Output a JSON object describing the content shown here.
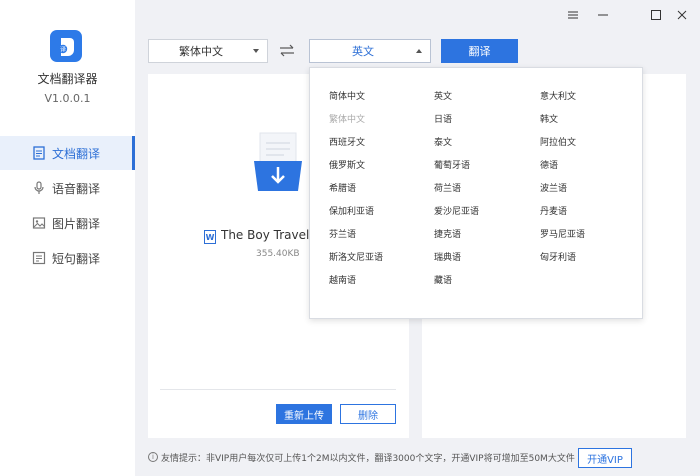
{
  "app": {
    "name": "文档翻译器",
    "version": "V1.0.0.1"
  },
  "nav": [
    {
      "label": "文档翻译",
      "icon": "document-icon",
      "active": true
    },
    {
      "label": "语音翻译",
      "icon": "microphone-icon",
      "active": false
    },
    {
      "label": "图片翻译",
      "icon": "image-icon",
      "active": false
    },
    {
      "label": "短句翻译",
      "icon": "text-icon",
      "active": false
    }
  ],
  "toolbar": {
    "source_lang": "繁体中文",
    "target_lang": "英文",
    "translate_label": "翻译"
  },
  "file": {
    "name": "The Boy Travellers",
    "size": "355.40KB",
    "type_letter": "W"
  },
  "actions": {
    "reupload": "重新上传",
    "delete": "删除"
  },
  "dropdown": {
    "col1": [
      "简体中文",
      "繁体中文",
      "西班牙文",
      "俄罗斯文",
      "希腊语",
      "保加利亚语",
      "芬兰语",
      "斯洛文尼亚语",
      "越南语"
    ],
    "col2": [
      "英文",
      "日语",
      "泰文",
      "葡萄牙语",
      "荷兰语",
      "爱沙尼亚语",
      "捷克语",
      "瑞典语",
      "藏语"
    ],
    "col3": [
      "意大利文",
      "韩文",
      "阿拉伯文",
      "德语",
      "波兰语",
      "丹麦语",
      "罗马尼亚语",
      "匈牙利语"
    ],
    "disabled": "繁体中文"
  },
  "footer": {
    "tip": "友情提示：非VIP用户每次仅可上传1个2M以内文件，翻译3000个文字，开通VIP将可增加至50M大文件",
    "vip_label": "开通VIP"
  },
  "colors": {
    "accent": "#2d74e0",
    "background": "#f0f1f5",
    "active_nav_bg": "#e9f0fb"
  }
}
